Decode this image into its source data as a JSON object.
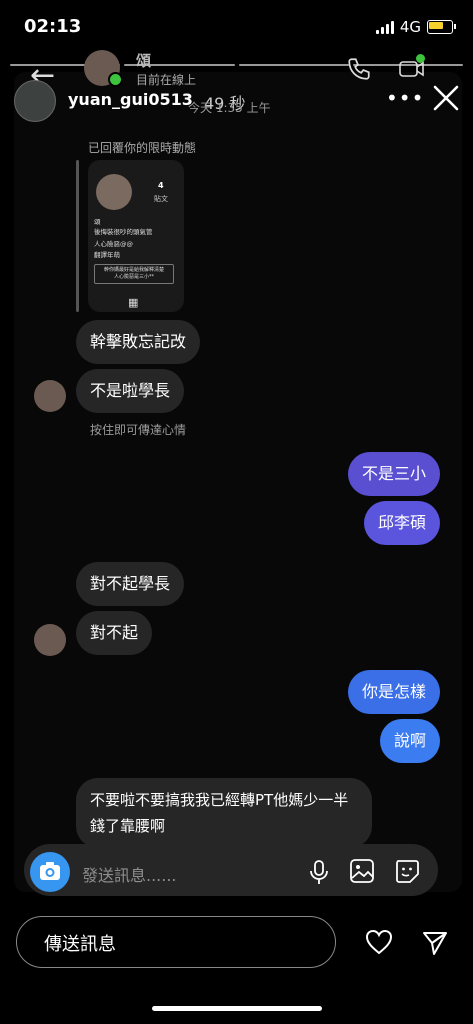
{
  "status_bar": {
    "time": "02:13",
    "network": "4G",
    "battery_color": "#f7d22c"
  },
  "dm_header": {
    "name": "頌",
    "active_status": "目前在線上",
    "online_color": "#3ec33e"
  },
  "story_header": {
    "username": "yuan_gui0513",
    "elapsed": "49 秒",
    "sent_time": "今天 1:35 上午"
  },
  "reply": {
    "label": "已回覆你的限時動態",
    "card": {
      "posts_count": "4",
      "posts_label": "貼文",
      "lines": [
        "頌",
        "後悔裝很吵的頭氣管",
        "人心險惡@@",
        "翻譯年萌"
      ],
      "box_line1": "幹你媽最好是給我解釋清楚",
      "box_line2": "人心險惡是三小**"
    }
  },
  "messages": {
    "in1": "幹擊敗忘記改",
    "in2": "不是啦學長",
    "hint": "按住即可傳達心情",
    "out1": "不是三小",
    "out2": "邱李碩",
    "in3": "對不起學長",
    "in4": "對不起",
    "out3": "你是怎樣",
    "out4": "說啊",
    "in5": "不要啦不要搞我我已經轉PT他媽少一半錢了靠腰啊"
  },
  "colors": {
    "outgoing_purple": "#5a4fd1",
    "outgoing_blue": "#3b7cf0",
    "incoming": "#262626",
    "camera_blue": "#3797f0"
  },
  "composer": {
    "placeholder": "發送訊息......"
  },
  "story_footer": {
    "input_label": "傳送訊息"
  },
  "icons": [
    "back-arrow-icon",
    "phone-icon",
    "video-icon",
    "more-icon",
    "close-icon",
    "camera-icon",
    "mic-icon",
    "image-icon",
    "sticker-icon",
    "heart-icon",
    "send-icon",
    "grid-icon"
  ]
}
